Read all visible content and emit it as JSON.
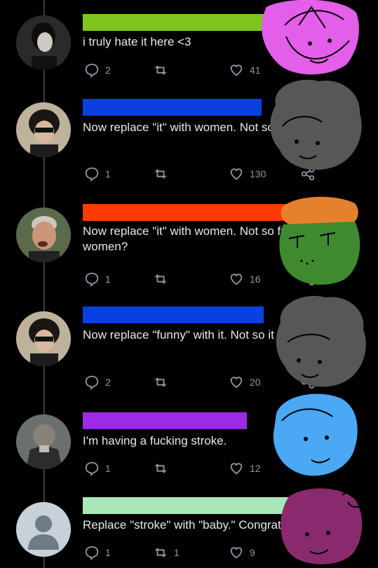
{
  "tweets": [
    {
      "name_bar_color": "#7dc51f",
      "text": "i truly hate it here <3",
      "replies": "2",
      "retweets": "",
      "likes": "41",
      "show_share": false
    },
    {
      "name_bar_color": "#0a3fe0",
      "text": "Now replace \"it\" with women. Not so funny now is it?",
      "replies": "1",
      "retweets": "",
      "likes": "130",
      "show_share": true
    },
    {
      "name_bar_color": "#ff3a05",
      "text": "Now replace \"it\" with women. Not so funny now is women?",
      "replies": "1",
      "retweets": "",
      "likes": "16",
      "show_share": true
    },
    {
      "name_bar_color": "#0a3fe0",
      "text": "Now replace \"funny\" with it. Not so it now is women?",
      "replies": "2",
      "retweets": "",
      "likes": "20",
      "show_share": true
    },
    {
      "name_bar_color": "#9b2be6",
      "text": "I'm having a fucking stroke.",
      "replies": "1",
      "retweets": "",
      "likes": "12",
      "show_share": false
    },
    {
      "name_bar_color": "#a8e8b6",
      "text": "Replace \"stroke\" with \"baby.\" Congratulations.",
      "replies": "1",
      "retweets": "1",
      "likes": "9",
      "show_share": true
    }
  ],
  "doodle_colors": {
    "pink": "#e35ee9",
    "gray": "#595656",
    "green_body": "#3f8a2f",
    "orange_hair": "#e5812d",
    "blue": "#4aa8f5",
    "magenta": "#8a2a6e"
  },
  "icons": [
    "reply-icon",
    "retweet-icon",
    "like-icon",
    "share-icon"
  ]
}
